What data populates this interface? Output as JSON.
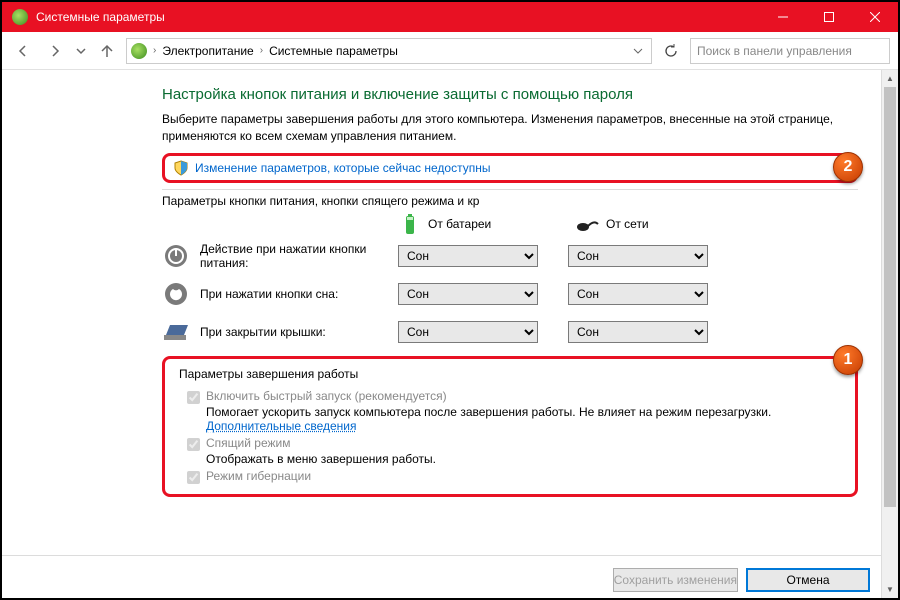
{
  "window": {
    "title": "Системные параметры"
  },
  "breadcrumb": {
    "item1": "Электропитание",
    "item2": "Системные параметры"
  },
  "search": {
    "placeholder": "Поиск в панели управления"
  },
  "page": {
    "heading": "Настройка кнопок питания и включение защиты с помощью пароля",
    "intro": "Выберите параметры завершения работы для этого компьютера. Изменения параметров, внесенные на этой странице, применяются ко всем схемам управления питанием.",
    "unlock_link": "Изменение параметров, которые сейчас недоступны",
    "section1": "Параметры кнопки питания, кнопки спящего режима и кр",
    "col_battery": "От батареи",
    "col_ac": "От сети",
    "row1": "Действие при нажатии кнопки питания:",
    "row2": "При нажатии кнопки сна:",
    "row3": "При закрытии крышки:",
    "opt_sleep": "Сон",
    "section2": "Параметры завершения работы",
    "cb1": "Включить быстрый запуск (рекомендуется)",
    "cb1_desc": "Помогает ускорить запуск компьютера после завершения работы. Не влияет на режим перезагрузки. ",
    "cb1_link": "Дополнительные сведения",
    "cb2": "Спящий режим",
    "cb2_desc": "Отображать в меню завершения работы.",
    "cb3": "Режим гибернации"
  },
  "buttons": {
    "save": "Сохранить изменения",
    "cancel": "Отмена"
  },
  "badges": {
    "one": "1",
    "two": "2"
  }
}
